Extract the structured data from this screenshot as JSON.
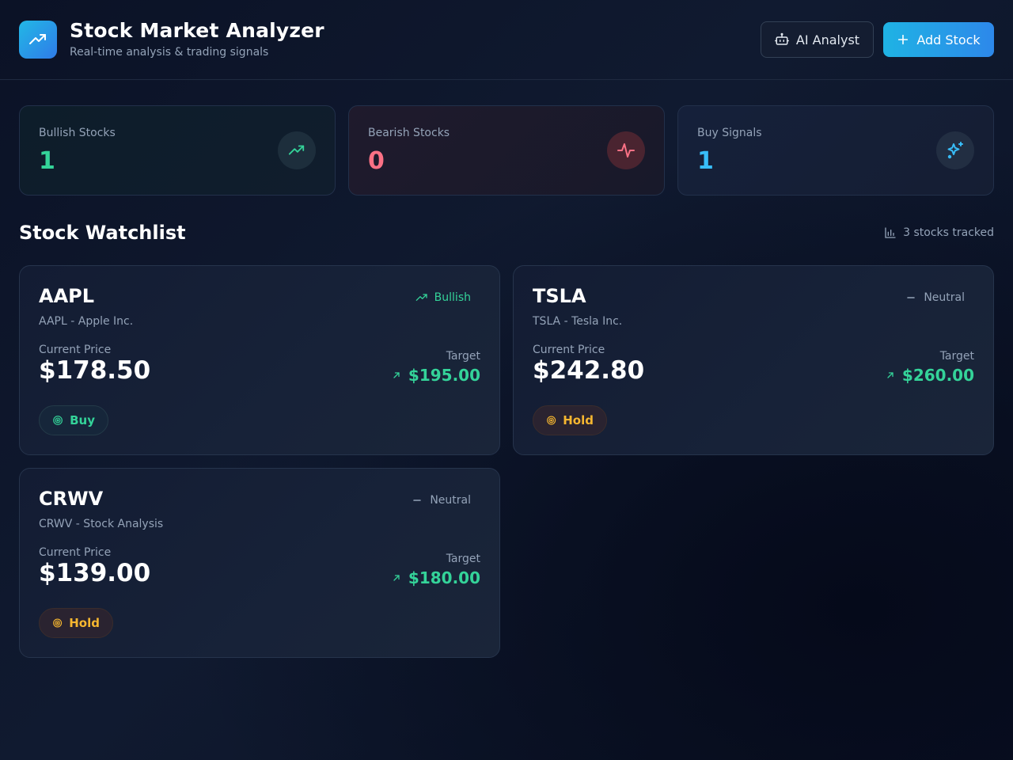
{
  "header": {
    "title": "Stock Market Analyzer",
    "subtitle": "Real-time analysis & trading signals",
    "logo_icon": "trending-up-icon",
    "ai_button_label": "AI Analyst",
    "ai_button_icon": "robot-icon",
    "add_button_label": "Add Stock",
    "add_button_icon": "plus-icon"
  },
  "stats": [
    {
      "label": "Bullish Stocks",
      "value": "1",
      "icon": "trending-up-icon",
      "color": "#34d399"
    },
    {
      "label": "Bearish Stocks",
      "value": "0",
      "icon": "activity-icon",
      "color": "#fb7185"
    },
    {
      "label": "Buy Signals",
      "value": "1",
      "icon": "sparkles-icon",
      "color": "#38bdf8"
    }
  ],
  "watchlist": {
    "title": "Stock Watchlist",
    "tracked": "3 stocks tracked",
    "tracked_icon": "bar-chart-icon",
    "current_price_label": "Current Price",
    "target_label": "Target",
    "stocks": [
      {
        "ticker": "AAPL",
        "company": "AAPL - Apple Inc.",
        "sentiment": "Bullish",
        "sentiment_icon": "trending-up-icon",
        "price": "$178.50",
        "target": "$195.00",
        "signal": "Buy",
        "signal_icon": "target-icon"
      },
      {
        "ticker": "TSLA",
        "company": "TSLA - Tesla Inc.",
        "sentiment": "Neutral",
        "sentiment_icon": "minus-icon",
        "price": "$242.80",
        "target": "$260.00",
        "signal": "Hold",
        "signal_icon": "target-icon"
      },
      {
        "ticker": "CRWV",
        "company": "CRWV - Stock Analysis",
        "sentiment": "Neutral",
        "sentiment_icon": "minus-icon",
        "price": "$139.00",
        "target": "$180.00",
        "signal": "Hold",
        "signal_icon": "target-icon"
      }
    ]
  },
  "colors": {
    "bullish": "#34d399",
    "bearish": "#fb7185",
    "accent": "#38bdf8",
    "hold": "#f5b630",
    "neutral": "#94a3b8"
  }
}
